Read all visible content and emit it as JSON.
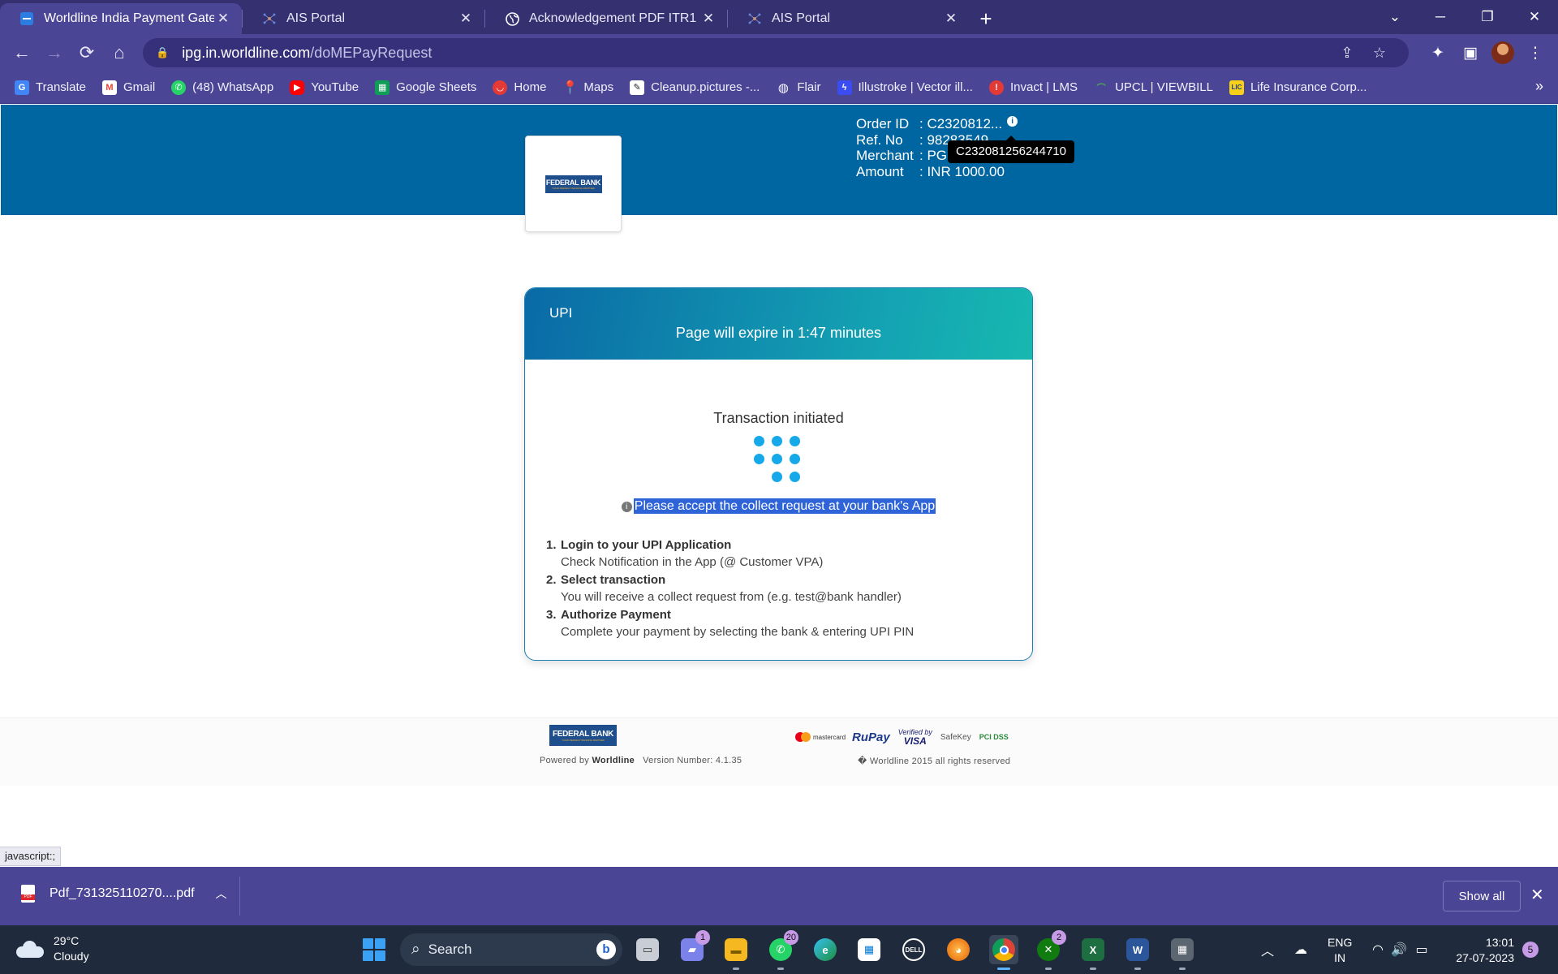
{
  "browser": {
    "tabs": [
      {
        "title": "Worldline India Payment Gateway",
        "icon": "worldline-favicon",
        "active": true
      },
      {
        "title": "AIS Portal",
        "icon": "ais-favicon",
        "active": false
      },
      {
        "title": "Acknowledgement PDF ITR1",
        "icon": "globe-icon",
        "active": false
      },
      {
        "title": "AIS Portal",
        "icon": "ais-favicon",
        "active": false
      }
    ],
    "url_host": "ipg.in.worldline.com",
    "url_path": "/doMEPayRequest",
    "bookmarks": [
      {
        "label": "Translate",
        "icon": "google-translate-icon",
        "color": "#4285f4"
      },
      {
        "label": "Gmail",
        "icon": "gmail-icon",
        "color": "#ea4335"
      },
      {
        "label": "(48) WhatsApp",
        "icon": "whatsapp-icon",
        "color": "#25d366"
      },
      {
        "label": "YouTube",
        "icon": "youtube-icon",
        "color": "#ff0000"
      },
      {
        "label": "Google Sheets",
        "icon": "sheets-icon",
        "color": "#0f9d58"
      },
      {
        "label": "Home",
        "icon": "home-site-icon",
        "color": "#e53935"
      },
      {
        "label": "Maps",
        "icon": "maps-icon",
        "color": "#34a853"
      },
      {
        "label": "Cleanup.pictures -...",
        "icon": "cleanup-icon",
        "color": "#222222"
      },
      {
        "label": "Flair",
        "icon": "globe-icon",
        "color": "#ffffff"
      },
      {
        "label": "Illustroke | Vector ill...",
        "icon": "illustroke-icon",
        "color": "#3b4cf0"
      },
      {
        "label": "Invact | LMS",
        "icon": "invact-icon",
        "color": "#e53935"
      },
      {
        "label": "UPCL | VIEWBILL",
        "icon": "upcl-icon",
        "color": "#2e7d32"
      },
      {
        "label": "Life Insurance Corp...",
        "icon": "lic-icon",
        "color": "#1e3a8a"
      }
    ]
  },
  "page": {
    "bank_name": "FEDERAL BANK",
    "bank_tagline": "YOUR PERFECT BANKING PARTNER",
    "order": {
      "order_id_label": "Order ID",
      "order_id_value": ": C2320812...",
      "ref_label": "Ref. No",
      "ref_value": ": 98283549",
      "merchant_label": "Merchant",
      "merchant_value": ": PG C",
      "amount_label": "Amount",
      "amount_value": ": INR 1000.00",
      "tooltip": "C232081256244710"
    },
    "upi": {
      "label": "UPI",
      "expire_text": "Page will expire in 1:47 minutes",
      "status": "Transaction initiated",
      "notice": "Please accept the collect request at your bank's App",
      "steps": [
        {
          "num": "1.",
          "title": "Login to your UPI Application",
          "desc": "Check Notification in the App (@ Customer VPA)"
        },
        {
          "num": "2.",
          "title": "Select transaction",
          "desc": "You will receive a collect request from (e.g. test@bank handler)"
        },
        {
          "num": "3.",
          "title": "Authorize Payment",
          "desc": "Complete your payment by selecting the bank & entering UPI PIN"
        }
      ]
    },
    "footer": {
      "powered_prefix": "Powered by",
      "powered_brand": "Worldline",
      "version": "Version Number: 4.1.35",
      "rights": "� Worldline 2015 all rights reserved",
      "mastercard": "mastercard",
      "rupay": "RuPay",
      "vbv_top": "Verified by",
      "vbv_bottom": "VISA",
      "safekey": "SafeKey",
      "pci": "PCI DSS"
    }
  },
  "status_bar": "javascript:;",
  "downloads": {
    "file": "Pdf_731325110270....pdf",
    "show_all": "Show all"
  },
  "taskbar": {
    "temp": "29°C",
    "weather": "Cloudy",
    "search_placeholder": "Search",
    "lang_top": "ENG",
    "lang_bottom": "IN",
    "time": "13:01",
    "date": "27-07-2023",
    "notifications": "5",
    "apps": [
      {
        "name": "task-view-icon",
        "badge": ""
      },
      {
        "name": "teams-chat-icon",
        "badge": "1"
      },
      {
        "name": "file-explorer-icon",
        "badge": ""
      },
      {
        "name": "whatsapp-icon",
        "badge": "20"
      },
      {
        "name": "edge-icon",
        "badge": ""
      },
      {
        "name": "microsoft-store-icon",
        "badge": ""
      },
      {
        "name": "dell-icon",
        "badge": ""
      },
      {
        "name": "firefox-icon",
        "badge": ""
      },
      {
        "name": "chrome-icon",
        "badge": ""
      },
      {
        "name": "xbox-icon",
        "badge": "2"
      },
      {
        "name": "excel-icon",
        "badge": ""
      },
      {
        "name": "word-icon",
        "badge": ""
      },
      {
        "name": "calculator-icon",
        "badge": ""
      }
    ]
  }
}
